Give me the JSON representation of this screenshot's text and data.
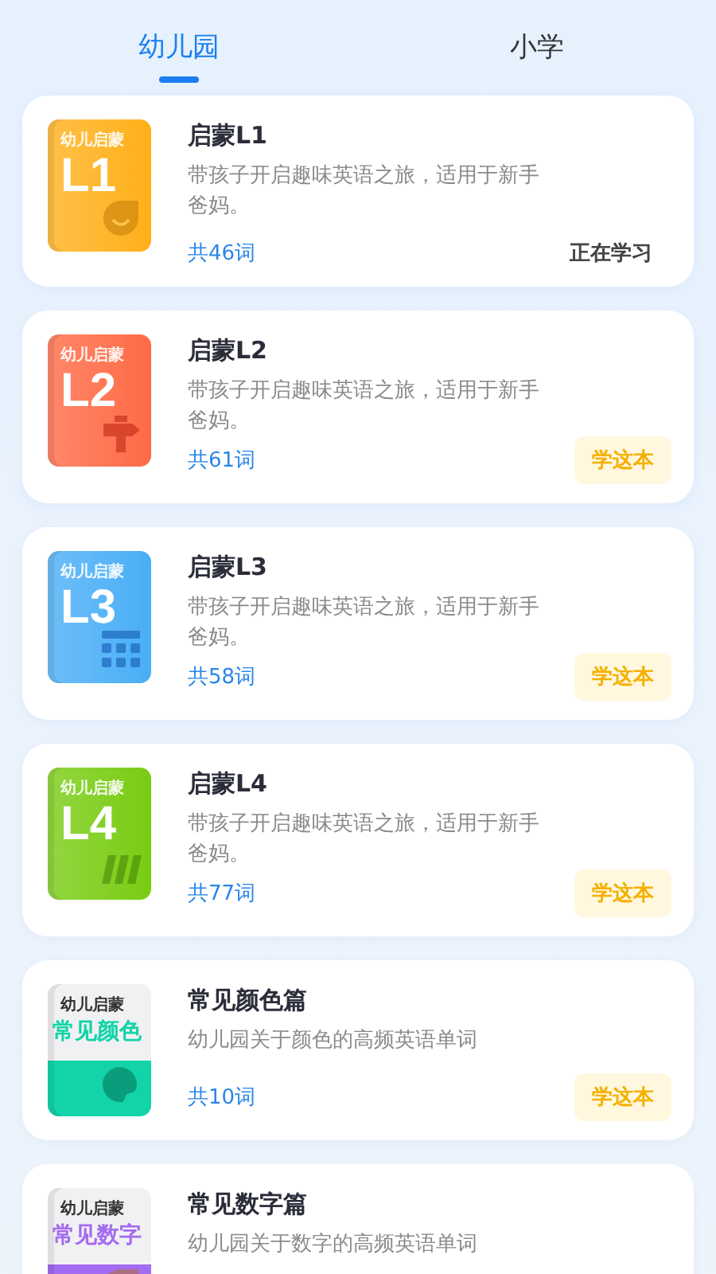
{
  "tabs": [
    {
      "label": "幼儿园",
      "selected": true
    },
    {
      "label": "小学",
      "selected": false
    }
  ],
  "books": [
    {
      "cover": {
        "kind": "level",
        "label": "幼儿启蒙",
        "text": "L1",
        "color": "#ffb01a"
      },
      "title": "启蒙L1",
      "description": "带孩子开启趣味英语之旅，适用于新手爸妈。",
      "count": "共46词",
      "action": {
        "kind": "status",
        "label": "正在学习"
      }
    },
    {
      "cover": {
        "kind": "level",
        "label": "幼儿启蒙",
        "text": "L2",
        "color": "#ff6a45"
      },
      "title": "启蒙L2",
      "description": "带孩子开启趣味英语之旅，适用于新手爸妈。",
      "count": "共61词",
      "action": {
        "kind": "button",
        "label": "学这本"
      }
    },
    {
      "cover": {
        "kind": "level",
        "label": "幼儿启蒙",
        "text": "L3",
        "color": "#49aef6"
      },
      "title": "启蒙L3",
      "description": "带孩子开启趣味英语之旅，适用于新手爸妈。",
      "count": "共58词",
      "action": {
        "kind": "button",
        "label": "学这本"
      }
    },
    {
      "cover": {
        "kind": "level",
        "label": "幼儿启蒙",
        "text": "L4",
        "color": "#78cc12"
      },
      "title": "启蒙L4",
      "description": "带孩子开启趣味英语之旅，适用于新手爸妈。",
      "count": "共77词",
      "action": {
        "kind": "button",
        "label": "学这本"
      }
    },
    {
      "cover": {
        "kind": "topic",
        "label": "幼儿启蒙",
        "text": "常见颜色",
        "color": "#12d4a8"
      },
      "title": "常见颜色篇",
      "description": "幼儿园关于颜色的高频英语单词",
      "count": "共10词",
      "action": {
        "kind": "button",
        "label": "学这本"
      }
    },
    {
      "cover": {
        "kind": "topic",
        "label": "幼儿启蒙",
        "text": "常见数字",
        "color": "#a46cf0"
      },
      "title": "常见数字篇",
      "description": "幼儿园关于数字的高频英语单词"
    }
  ]
}
